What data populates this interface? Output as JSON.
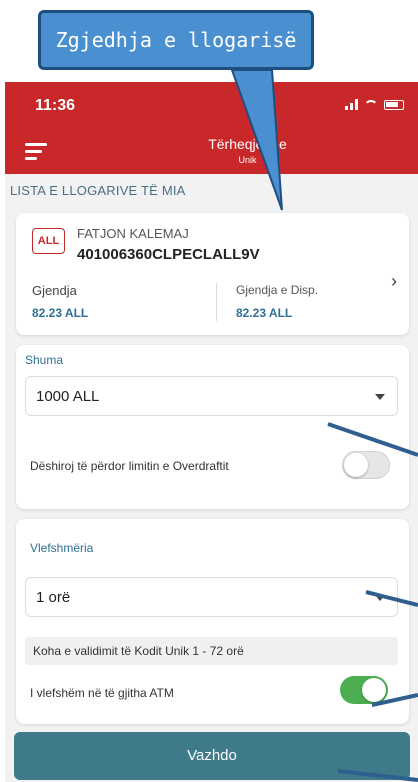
{
  "callout": {
    "text": "Zgjedhja e llogarisë"
  },
  "status_bar": {
    "time": "11:36"
  },
  "header": {
    "title": "Tërheqje me",
    "subtitle": "Unik"
  },
  "accounts_section": {
    "label": "LISTA E LLOGARIVE TË MIA"
  },
  "account": {
    "currency_badge": "ALL",
    "holder_name": "FATJON KALEMAJ",
    "number": "401006360CLPECLALL9V",
    "balance_label": "Gjendja",
    "balance_value": "82.23 ALL",
    "available_label": "Gjendja e Disp.",
    "available_value": "82.23 ALL"
  },
  "amount": {
    "label": "Shuma",
    "selected": "1000 ALL",
    "overdraft_label": "Dëshiroj të përdor limitin e Overdraftit",
    "overdraft_enabled": false
  },
  "validity": {
    "label": "Vlefshmëria",
    "selected": "1 orë",
    "info": "Koha e validimit të Kodit Unik 1 - 72 orë",
    "all_atm_label": "I vlefshëm në të gjitha ATM",
    "all_atm_enabled": true
  },
  "actions": {
    "continue_label": "Vazhdo"
  },
  "colors": {
    "brand_red": "#c8282a",
    "accent_teal": "#2e6f94",
    "button": "#3f7a8a",
    "toggle_on": "#4cae50",
    "callout": "#4a8fd0",
    "pointer": "#2f5f8f"
  }
}
